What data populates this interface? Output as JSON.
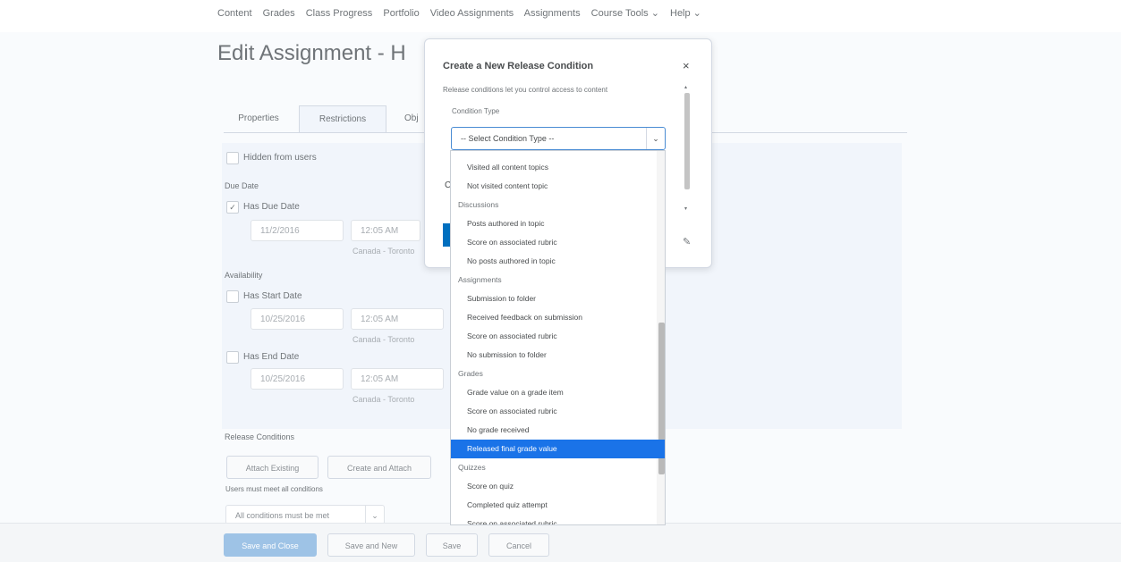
{
  "nav": {
    "items": [
      "Content",
      "Grades",
      "Class Progress",
      "Portfolio",
      "Video Assignments",
      "Assignments",
      "Course Tools ⌄",
      "Help ⌄"
    ]
  },
  "page": {
    "title": "Edit Assignment - H"
  },
  "tabs": [
    {
      "label": "Properties"
    },
    {
      "label": "Restrictions"
    },
    {
      "label": "Obj"
    }
  ],
  "restrictions": {
    "hidden_label": "Hidden from users",
    "due_heading": "Due Date",
    "has_due_label": "Has Due Date",
    "due_date": "11/2/2016",
    "due_time": "12:05 AM",
    "due_tz": "Canada - Toronto",
    "avail_heading": "Availability",
    "start_label": "Has Start Date",
    "start_date": "10/25/2016",
    "start_time": "12:05 AM",
    "start_tz": "Canada - Toronto",
    "end_label": "Has End Date",
    "end_date": "10/25/2016",
    "end_time": "12:05 AM",
    "end_tz": "Canada - Toronto",
    "release_heading": "Release Conditions",
    "attach_existing": "Attach Existing",
    "create_attach": "Create and Attach",
    "release_note": "Users must meet all conditions",
    "release_select": "All conditions must be met",
    "release_chev": "⌄"
  },
  "footer": {
    "save_close": "Save and Close",
    "save_new": "Save and New",
    "save": "Save",
    "cancel": "Cancel"
  },
  "modal": {
    "title": "Create a New Release Condition",
    "close": "×",
    "description": "Release conditions let you control access to content",
    "condition_type_label": "Condition Type",
    "select_value": "-- Select Condition Type --",
    "select_chev": "⌄",
    "pencil": "✎"
  },
  "dropdown": [
    {
      "label": "Visited all content topics",
      "kind": "opt"
    },
    {
      "label": "Not visited content topic",
      "kind": "opt"
    },
    {
      "label": "Discussions",
      "kind": "group"
    },
    {
      "label": "Posts authored in topic",
      "kind": "opt"
    },
    {
      "label": "Score on associated rubric",
      "kind": "opt"
    },
    {
      "label": "No posts authored in topic",
      "kind": "opt"
    },
    {
      "label": "Assignments",
      "kind": "group"
    },
    {
      "label": "Submission to folder",
      "kind": "opt"
    },
    {
      "label": "Received feedback on submission",
      "kind": "opt"
    },
    {
      "label": "Score on associated rubric",
      "kind": "opt"
    },
    {
      "label": "No submission to folder",
      "kind": "opt"
    },
    {
      "label": "Grades",
      "kind": "group"
    },
    {
      "label": "Grade value on a grade item",
      "kind": "opt"
    },
    {
      "label": "Score on associated rubric",
      "kind": "opt"
    },
    {
      "label": "No grade received",
      "kind": "opt"
    },
    {
      "label": "Released final grade value",
      "kind": "opt",
      "selected": true
    },
    {
      "label": "Quizzes",
      "kind": "group"
    },
    {
      "label": "Score on quiz",
      "kind": "opt"
    },
    {
      "label": "Completed quiz attempt",
      "kind": "opt"
    },
    {
      "label": "Score on associated rubric",
      "kind": "opt"
    }
  ]
}
